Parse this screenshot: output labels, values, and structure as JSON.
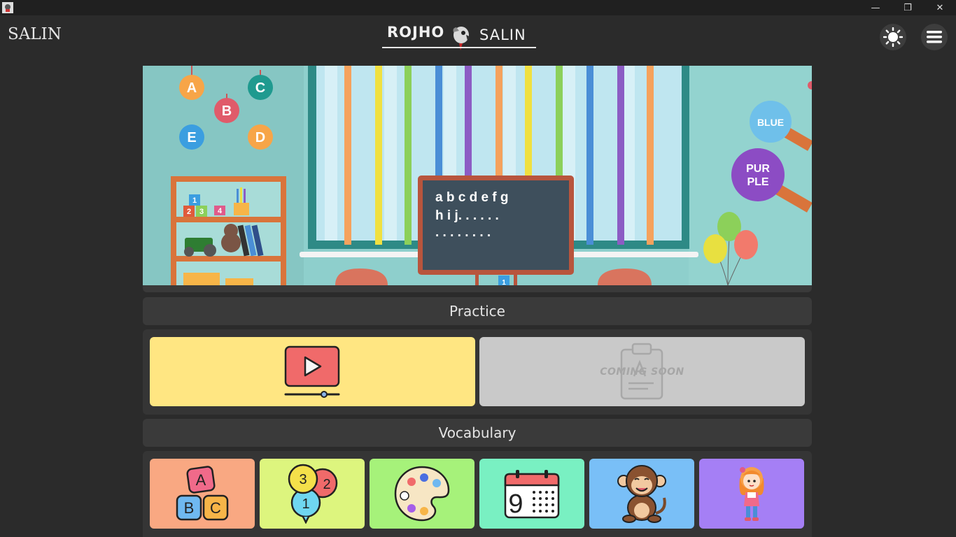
{
  "window": {
    "controls": {
      "minimize": "—",
      "maximize": "❐",
      "close": "✕"
    }
  },
  "header": {
    "app_name": "SALIN",
    "logo": {
      "left_text": "ROJHO",
      "right_text": "SALIN"
    },
    "theme_toggle_icon": "sun-icon",
    "menu_icon": "hamburger-menu-icon"
  },
  "banner": {
    "letters": [
      "A",
      "B",
      "C",
      "D",
      "E"
    ],
    "blackboard_lines": [
      "a b c d e f g",
      "h i j. . . . . .",
      ". . . . . . . ."
    ],
    "sign_blue": "BLUE",
    "sign_purple_line1": "PUR",
    "sign_purple_line2": "PLE",
    "blocks": [
      "1",
      "2",
      "3",
      "4"
    ],
    "easel_number": "1"
  },
  "practice": {
    "title": "Practice",
    "cards": [
      {
        "name": "video-lesson",
        "icon": "video-play-icon",
        "color": "#ffe682"
      },
      {
        "name": "quiz",
        "icon": "clipboard-icon",
        "label": "COMING SOON",
        "color": "#c9c9c9"
      }
    ]
  },
  "vocabulary": {
    "title": "Vocabulary",
    "cards": [
      {
        "name": "alphabet",
        "icon": "abc-blocks-icon",
        "color": "#f9a882",
        "letters": [
          "A",
          "B",
          "C"
        ]
      },
      {
        "name": "numbers",
        "icon": "number-bubbles-icon",
        "color": "#ddf57e",
        "digits": [
          "3",
          "2",
          "1"
        ]
      },
      {
        "name": "colors",
        "icon": "paint-palette-icon",
        "color": "#a6f27a"
      },
      {
        "name": "calendar",
        "icon": "calendar-icon",
        "color": "#79f0c2",
        "day": "9"
      },
      {
        "name": "animals",
        "icon": "monkey-icon",
        "color": "#79bff7"
      },
      {
        "name": "people",
        "icon": "girl-icon",
        "color": "#a57ff5"
      }
    ]
  }
}
